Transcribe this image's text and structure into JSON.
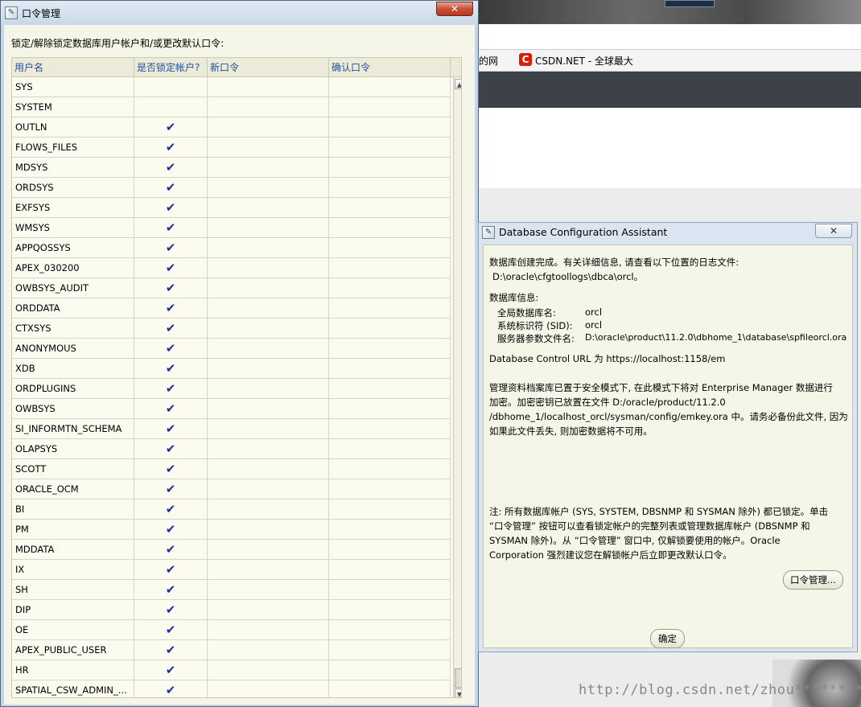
{
  "background": {
    "tabs": [
      "的网",
      "CSDN.NET - 全球最大"
    ],
    "csdn_logo": "C",
    "watermark": "http://blog.csdn.net/zhou********"
  },
  "password_window": {
    "title": "口令管理",
    "close_label": "✕",
    "description": "锁定/解除锁定数据库用户帐户和/或更改默认口令:",
    "columns": [
      "用户名",
      "是否锁定帐户?",
      "新口令",
      "确认口令"
    ],
    "rows": [
      {
        "user": "SYS",
        "locked": ""
      },
      {
        "user": "SYSTEM",
        "locked": ""
      },
      {
        "user": "OUTLN",
        "locked": "✔"
      },
      {
        "user": "FLOWS_FILES",
        "locked": "✔"
      },
      {
        "user": "MDSYS",
        "locked": "✔"
      },
      {
        "user": "ORDSYS",
        "locked": "✔"
      },
      {
        "user": "EXFSYS",
        "locked": "✔"
      },
      {
        "user": "WMSYS",
        "locked": "✔"
      },
      {
        "user": "APPQOSSYS",
        "locked": "✔"
      },
      {
        "user": "APEX_030200",
        "locked": "✔"
      },
      {
        "user": "OWBSYS_AUDIT",
        "locked": "✔"
      },
      {
        "user": "ORDDATA",
        "locked": "✔"
      },
      {
        "user": "CTXSYS",
        "locked": "✔"
      },
      {
        "user": "ANONYMOUS",
        "locked": "✔"
      },
      {
        "user": "XDB",
        "locked": "✔"
      },
      {
        "user": "ORDPLUGINS",
        "locked": "✔"
      },
      {
        "user": "OWBSYS",
        "locked": "✔"
      },
      {
        "user": "SI_INFORMTN_SCHEMA",
        "locked": "✔"
      },
      {
        "user": "OLAPSYS",
        "locked": "✔"
      },
      {
        "user": "SCOTT",
        "locked": "✔"
      },
      {
        "user": "ORACLE_OCM",
        "locked": "✔"
      },
      {
        "user": "BI",
        "locked": "✔"
      },
      {
        "user": "PM",
        "locked": "✔"
      },
      {
        "user": "MDDATA",
        "locked": "✔"
      },
      {
        "user": "IX",
        "locked": "✔"
      },
      {
        "user": "SH",
        "locked": "✔"
      },
      {
        "user": "DIP",
        "locked": "✔"
      },
      {
        "user": "OE",
        "locked": "✔"
      },
      {
        "user": "APEX_PUBLIC_USER",
        "locked": "✔"
      },
      {
        "user": "HR",
        "locked": "✔"
      },
      {
        "user": "SPATIAL_CSW_ADMIN_...",
        "locked": "✔"
      }
    ],
    "scroll_up": "▲",
    "scroll_down": "▼"
  },
  "dbca_window": {
    "title": "Database Configuration Assistant",
    "close_label": "✕",
    "line1": "数据库创建完成。有关详细信息, 请查看以下位置的日志文件:",
    "log_path": "D:\\oracle\\cfgtoollogs\\dbca\\orcl。",
    "info_heading": "数据库信息:",
    "info": [
      {
        "key": "全局数据库名:",
        "value": "orcl"
      },
      {
        "key": "系统标识符 (SID):",
        "value": "orcl"
      },
      {
        "key": "服务器参数文件名:",
        "value": "D:\\oracle\\product\\11.2.0\\dbhome_1\\database\\spfileorcl.ora"
      }
    ],
    "em_url": "Database Control URL 为 https://localhost:1158/em",
    "repo_lines": [
      "管理资料档案库已置于安全模式下, 在此模式下将对 Enterprise Manager 数据进行",
      "加密。加密密钥已放置在文件 D:/oracle/product/11.2.0",
      "/dbhome_1/localhost_orcl/sysman/config/emkey.ora 中。请务必备份此文件, 因为",
      "如果此文件丢失, 则加密数据将不可用。"
    ],
    "note_lines": [
      "注: 所有数据库帐户 (SYS, SYSTEM, DBSNMP 和 SYSMAN 除外) 都已锁定。单击",
      "“口令管理” 按钮可以查看锁定帐户的完整列表或管理数据库帐户 (DBSNMP 和",
      "SYSMAN 除外)。从 “口令管理” 窗口中, 仅解锁要使用的帐户。Oracle",
      "Corporation 强烈建议您在解锁帐户后立即更改默认口令。"
    ],
    "password_button": "口令管理...",
    "ok_button": "确定"
  }
}
